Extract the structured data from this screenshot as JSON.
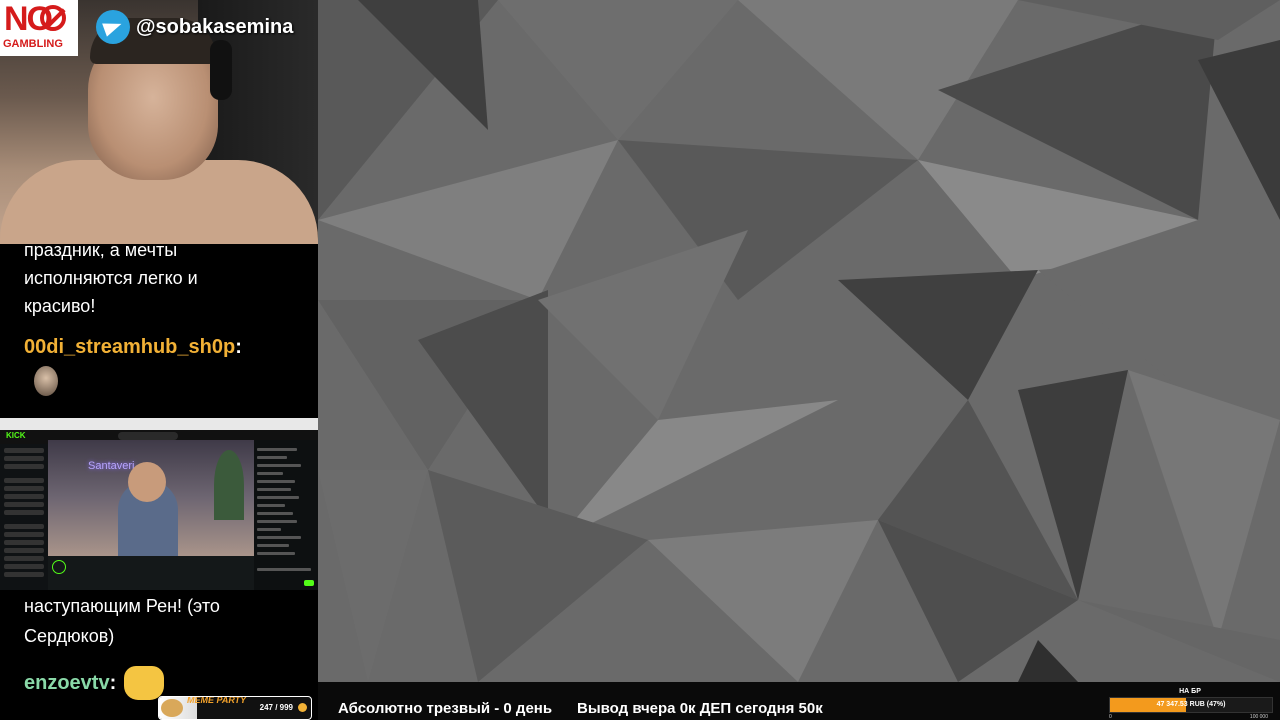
{
  "overlay": {
    "no_gambling_no": "NO",
    "no_gambling_text": "GAMBLING",
    "telegram_handle": "@sobakasemina"
  },
  "chat_top": {
    "line1": "праздник, а мечты",
    "line2": "исполняются легко и",
    "line3": "красиво!",
    "username": "00di_streamhub_sh0p",
    "colon": ":"
  },
  "kick_window": {
    "logo": "KICK",
    "neon_sign": "Santaveri"
  },
  "chat_bottom": {
    "line1": "наступающим Рен! (это",
    "line2": "Сердюков)",
    "username": "enzoevtv",
    "colon": ":"
  },
  "meme_party": {
    "label": "MEME PARTY",
    "count": "247 / 999",
    "progress_fraction": 0.247
  },
  "ticker": {
    "text1": "Абсолютно трезвый - 0 день",
    "text2": "Вывод вчера 0к  ДЕП сегодня 50к"
  },
  "goal": {
    "title": "НА БР",
    "value": "47 347.53 RUB (47%)",
    "progress_percent": 47,
    "min": "0",
    "max": "100 000",
    "fill_color": "#f39a1d"
  }
}
